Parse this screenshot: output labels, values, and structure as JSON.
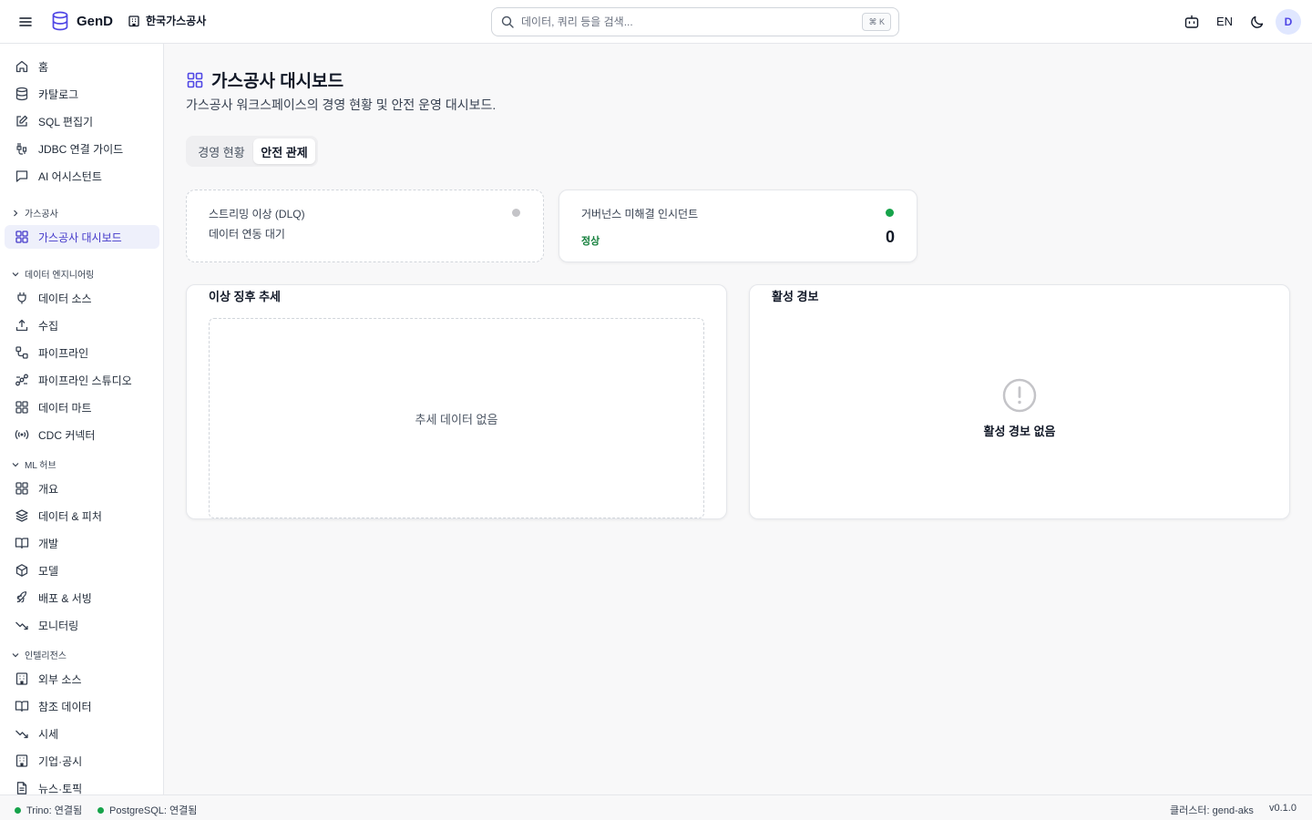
{
  "app": {
    "name": "GenD",
    "workspace": "한국가스공사"
  },
  "search": {
    "placeholder": "데이터, 쿼리 등을 검색...",
    "shortcut": "⌘ K"
  },
  "header": {
    "language": "EN",
    "avatar_initial": "D"
  },
  "sidebar": {
    "top_items": [
      {
        "label": "홈",
        "icon": "home-icon"
      },
      {
        "label": "카탈로그",
        "icon": "database-icon"
      },
      {
        "label": "SQL 편집기",
        "icon": "edit-icon"
      },
      {
        "label": "JDBC 연결 가이드",
        "icon": "link-icon"
      },
      {
        "label": "AI 어시스턴트",
        "icon": "chat-icon"
      }
    ],
    "gas_section": {
      "label": "가스공사",
      "items": [
        {
          "label": "가스공사 대시보드",
          "icon": "grid-icon",
          "active": true
        }
      ]
    },
    "de_section": {
      "label": "데이터 엔지니어링",
      "items": [
        {
          "label": "데이터 소스",
          "icon": "plug-icon"
        },
        {
          "label": "수집",
          "icon": "upload-icon"
        },
        {
          "label": "파이프라인",
          "icon": "pipeline-icon"
        },
        {
          "label": "파이프라인 스튜디오",
          "icon": "workflow-icon"
        },
        {
          "label": "데이터 마트",
          "icon": "grid-icon"
        },
        {
          "label": "CDC 커넥터",
          "icon": "radio-icon"
        }
      ]
    },
    "ml_section": {
      "label": "ML 허브",
      "items": [
        {
          "label": "개요",
          "icon": "grid-icon"
        },
        {
          "label": "데이터 & 피처",
          "icon": "layers-icon"
        },
        {
          "label": "개발",
          "icon": "book-icon"
        },
        {
          "label": "모델",
          "icon": "box-icon"
        },
        {
          "label": "배포 & 서빙",
          "icon": "rocket-icon"
        },
        {
          "label": "모니터링",
          "icon": "trend-down-icon"
        }
      ]
    },
    "intel_section": {
      "label": "인텔리전스",
      "items": [
        {
          "label": "외부 소스",
          "icon": "building-icon"
        },
        {
          "label": "참조 데이터",
          "icon": "book-icon"
        },
        {
          "label": "시세",
          "icon": "trend-down-icon"
        },
        {
          "label": "기업·공시",
          "icon": "building-icon"
        },
        {
          "label": "뉴스·토픽",
          "icon": "document-icon"
        }
      ]
    }
  },
  "page": {
    "title": "가스공사 대시보드",
    "subtitle": "가스공사 워크스페이스의 경영 현황 및 안전 운영 대시보드.",
    "tabs": [
      {
        "label": "경영 현황",
        "active": false
      },
      {
        "label": "안전 관제",
        "active": true
      }
    ]
  },
  "cards": {
    "dlq": {
      "label": "스트리밍 이상 (DLQ)",
      "status": "데이터 연동 대기",
      "dot_color": "#c4c4c8"
    },
    "governance": {
      "label": "거버넌스 미해결 인시던트",
      "status": "정상",
      "value": "0",
      "dot_color": "#16a34a"
    }
  },
  "panels": {
    "trend": {
      "title": "이상 징후 추세",
      "empty": "추세 데이터 없음"
    },
    "alerts": {
      "title": "활성 경보",
      "empty": "활성 경보 없음"
    }
  },
  "statusbar": {
    "trino": "Trino: 연결됨",
    "postgres": "PostgreSQL: 연결됨",
    "cluster": "클러스터: gend-aks",
    "version": "v0.1.0"
  },
  "colors": {
    "accent": "#4f46e5",
    "ok": "#16a34a",
    "active_bg": "#eef0fb"
  }
}
